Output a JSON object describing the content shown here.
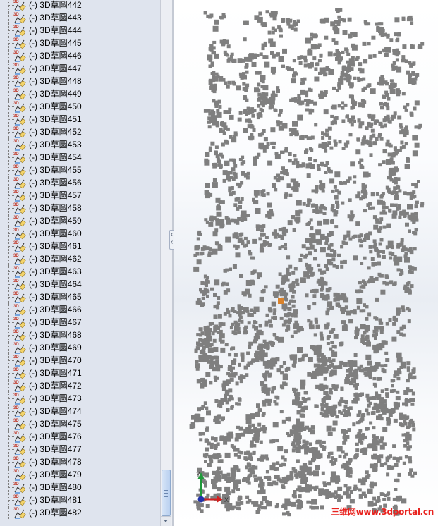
{
  "feature_tree": {
    "items": [
      {
        "prefix": "(-)",
        "name": "3D草圖442"
      },
      {
        "prefix": "(-)",
        "name": "3D草圖443"
      },
      {
        "prefix": "(-)",
        "name": "3D草圖444"
      },
      {
        "prefix": "(-)",
        "name": "3D草圖445"
      },
      {
        "prefix": "(-)",
        "name": "3D草圖446"
      },
      {
        "prefix": "(-)",
        "name": "3D草圖447"
      },
      {
        "prefix": "(-)",
        "name": "3D草圖448"
      },
      {
        "prefix": "(-)",
        "name": "3D草圖449"
      },
      {
        "prefix": "(-)",
        "name": "3D草圖450"
      },
      {
        "prefix": "(-)",
        "name": "3D草圖451"
      },
      {
        "prefix": "(-)",
        "name": "3D草圖452"
      },
      {
        "prefix": "(-)",
        "name": "3D草圖453"
      },
      {
        "prefix": "(-)",
        "name": "3D草圖454"
      },
      {
        "prefix": "(-)",
        "name": "3D草圖455"
      },
      {
        "prefix": "(-)",
        "name": "3D草圖456"
      },
      {
        "prefix": "(-)",
        "name": "3D草圖457"
      },
      {
        "prefix": "(-)",
        "name": "3D草圖458"
      },
      {
        "prefix": "(-)",
        "name": "3D草圖459"
      },
      {
        "prefix": "(-)",
        "name": "3D草圖460"
      },
      {
        "prefix": "(-)",
        "name": "3D草圖461"
      },
      {
        "prefix": "(-)",
        "name": "3D草圖462"
      },
      {
        "prefix": "(-)",
        "name": "3D草圖463"
      },
      {
        "prefix": "(-)",
        "name": "3D草圖464"
      },
      {
        "prefix": "(-)",
        "name": "3D草圖465"
      },
      {
        "prefix": "(-)",
        "name": "3D草圖466"
      },
      {
        "prefix": "(-)",
        "name": "3D草圖467"
      },
      {
        "prefix": "(-)",
        "name": "3D草圖468"
      },
      {
        "prefix": "(-)",
        "name": "3D草圖469"
      },
      {
        "prefix": "(-)",
        "name": "3D草圖470"
      },
      {
        "prefix": "(-)",
        "name": "3D草圖471"
      },
      {
        "prefix": "(-)",
        "name": "3D草圖472"
      },
      {
        "prefix": "(-)",
        "name": "3D草圖473"
      },
      {
        "prefix": "(-)",
        "name": "3D草圖474"
      },
      {
        "prefix": "(-)",
        "name": "3D草圖475"
      },
      {
        "prefix": "(-)",
        "name": "3D草圖476"
      },
      {
        "prefix": "(-)",
        "name": "3D草圖477"
      },
      {
        "prefix": "(-)",
        "name": "3D草圖478"
      },
      {
        "prefix": "(-)",
        "name": "3D草圖479"
      },
      {
        "prefix": "(-)",
        "name": "3D草圖480"
      },
      {
        "prefix": "(-)",
        "name": "3D草圖481"
      },
      {
        "prefix": "(-)",
        "name": "3D草圖482"
      }
    ],
    "icon": "3d-sketch-icon",
    "icon_badge": "3D"
  },
  "viewport": {
    "triad": {
      "x_label": "X",
      "y_label": "Y"
    },
    "watermark": "三维网www.3dportal.cn"
  },
  "colors": {
    "panel_bg": "#dfe4ee",
    "sketch_gray": "#7f7f7f",
    "highlight_orange": "#d9822b",
    "axis_red": "#d42020",
    "axis_green": "#1f9a3a",
    "axis_blue": "#2233aa",
    "watermark_red": "#e8231f"
  }
}
